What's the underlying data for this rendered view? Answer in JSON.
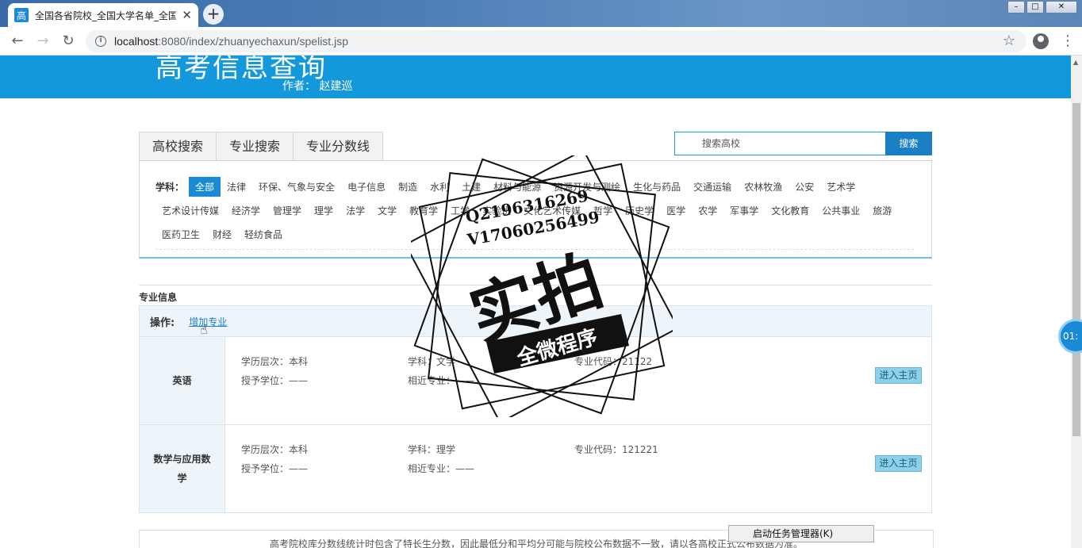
{
  "browser": {
    "tab_favicon": "高",
    "tab_title": "全国各省院校_全国大学名单_全国",
    "tab_close": "✕",
    "new_tab": "+",
    "url_host": "localhost",
    "url_path": ":8080/index/zhuanyechaxun/spelist.jsp",
    "win_min": "–",
    "win_max": "□",
    "win_close": "✕"
  },
  "header": {
    "title": "高考信息查询",
    "author": "作者： 赵建巡"
  },
  "search": {
    "tabs": [
      {
        "label": "高校搜索"
      },
      {
        "label": "专业搜索"
      },
      {
        "label": "专业分数线"
      }
    ],
    "input_value": "搜索高校",
    "button": "搜索"
  },
  "subjects": {
    "label": "学科：",
    "row1": [
      "全部",
      "法律",
      "环保、气象与安全",
      "电子信息",
      "制造",
      "水利",
      "土建",
      "材料与能源",
      "资源开发与测绘",
      "生化与药品",
      "交通运输",
      "农林牧渔",
      "公安",
      "艺术学"
    ],
    "row2": [
      "艺术设计传媒",
      "经济学",
      "管理学",
      "理学",
      "法学",
      "文学",
      "教育学",
      "工学",
      "实验班",
      "文化艺术传媒",
      "哲学",
      "历史学",
      "医学",
      "农学",
      "军事学",
      "文化教育",
      "公共事业",
      "旅游"
    ],
    "row3": [
      "医药卫生",
      "财经",
      "轻纺食品"
    ],
    "active": "全部"
  },
  "majors_section": {
    "title": "专业信息",
    "ops_label": "操作:",
    "add_link": "增加专业",
    "rows": [
      {
        "name": "英语",
        "level": "学历层次：本科",
        "degree": "授予学位：——",
        "subject": "学科：文学",
        "related": "相近专业：——",
        "code": "专业代码：21122",
        "enter": "进入主页"
      },
      {
        "name": "数学与应用数学",
        "level": "学历层次：本科",
        "degree": "授予学位：——",
        "subject": "学科：理学",
        "related": "相近专业：——",
        "code": "专业代码：121221",
        "enter": "进入主页"
      }
    ]
  },
  "notice": "高考院校库分数线统计时包含了特长生分数，因此最低分和平均分可能与院校公布数据不一致，请以各高校正式公布数据为准。",
  "taskbar_popup": "启动任务管理器(K)",
  "side_widget": "01:",
  "watermark": {
    "line1": "Q2196316269",
    "line2": "V17060256499",
    "big": "实拍",
    "banner": "全微程序"
  }
}
